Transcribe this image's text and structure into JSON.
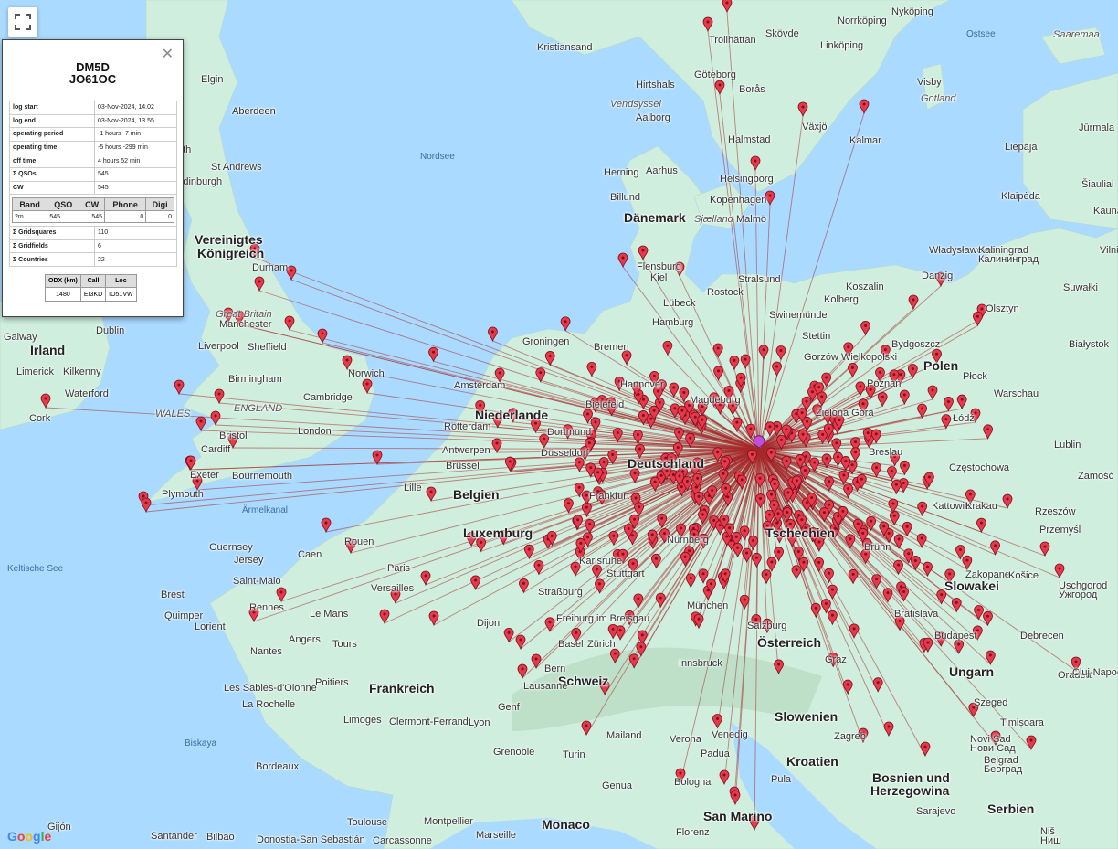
{
  "fullscreen_icon": "fullscreen-icon",
  "info": {
    "close_icon": "close-icon",
    "call": "DM5D",
    "locator": "JO61OC",
    "rows_top": [
      {
        "k": "log start",
        "v": "03-Nov-2024, 14.02"
      },
      {
        "k": "log end",
        "v": "03-Nov-2024, 13.55"
      },
      {
        "k": "operating period",
        "v": "-1 hours -7 min"
      },
      {
        "k": "operating time",
        "v": "-5 hours -299 min"
      },
      {
        "k": "off time",
        "v": "4 hours 52 min"
      },
      {
        "k": "Σ QSOs",
        "v": "545"
      },
      {
        "k": "CW",
        "v": "545"
      }
    ],
    "band_headers": [
      "Band",
      "QSO",
      "CW",
      "Phone",
      "Digi"
    ],
    "band_rows": [
      [
        "2m",
        "545",
        "545",
        "0",
        "0"
      ]
    ],
    "rows_bottom": [
      {
        "k": "Σ Gridsquares",
        "v": "110"
      },
      {
        "k": "Σ Gridfields",
        "v": "6"
      },
      {
        "k": "Σ Countries",
        "v": "22"
      }
    ],
    "odx_headers": [
      "ODX (km)",
      "Call",
      "Loc"
    ],
    "odx_row": [
      "1480",
      "EI3KD",
      "IO51VW"
    ]
  },
  "map": {
    "colors": {
      "sea": "#aadaff",
      "land": "#cfeedd",
      "line": "#a52a2a",
      "marker": "#e8394a",
      "home": "#c64bd8"
    },
    "home_marker_icon": "home-marker-icon",
    "station_marker_icon": "map-pin-icon",
    "labels": [
      {
        "t": "Vereinigtes",
        "c": "country"
      },
      {
        "t": "Königreich",
        "c": "country"
      },
      {
        "t": "Irland",
        "c": "country"
      },
      {
        "t": "Dänemark",
        "c": "country"
      },
      {
        "t": "Niederlande",
        "c": "country"
      },
      {
        "t": "Belgien",
        "c": "country"
      },
      {
        "t": "Luxemburg",
        "c": "country"
      },
      {
        "t": "Deutschland",
        "c": "country"
      },
      {
        "t": "Polen",
        "c": "country"
      },
      {
        "t": "Tschechien",
        "c": "country"
      },
      {
        "t": "Slowakei",
        "c": "country"
      },
      {
        "t": "Österreich",
        "c": "country"
      },
      {
        "t": "Ungarn",
        "c": "country"
      },
      {
        "t": "Schweiz",
        "c": "country"
      },
      {
        "t": "Frankreich",
        "c": "country"
      },
      {
        "t": "Slowenien",
        "c": "country"
      },
      {
        "t": "Kroatien",
        "c": "country"
      },
      {
        "t": "Bosnien und",
        "c": "country"
      },
      {
        "t": "Herzegowina",
        "c": "country"
      },
      {
        "t": "Serbien",
        "c": "country"
      },
      {
        "t": "Monaco",
        "c": "country"
      },
      {
        "t": "San Marino",
        "c": "country"
      },
      {
        "t": "Nordsee",
        "c": "sea"
      },
      {
        "t": "Ostsee",
        "c": "sea"
      },
      {
        "t": "Keltische See",
        "c": "sea"
      },
      {
        "t": "Ärmelkanal",
        "c": "sea"
      },
      {
        "t": "Biskaya",
        "c": "sea"
      },
      {
        "t": "Saaremaa",
        "c": "region"
      },
      {
        "t": "Gotland",
        "c": "region"
      },
      {
        "t": "Vendsyssel",
        "c": "region"
      },
      {
        "t": "Sjælland",
        "c": "region"
      },
      {
        "t": "Great Britain",
        "c": "region"
      },
      {
        "t": "ENGLAND",
        "c": "region"
      },
      {
        "t": "WALES",
        "c": "region"
      },
      {
        "t": "Guernsey",
        "c": "city"
      },
      {
        "t": "Jersey",
        "c": "city"
      },
      {
        "t": "Elgin",
        "c": "city"
      },
      {
        "t": "Aberdeen",
        "c": "city"
      },
      {
        "t": "Perth",
        "c": "city"
      },
      {
        "t": "St Andrews",
        "c": "city"
      },
      {
        "t": "Edinburgh",
        "c": "city"
      },
      {
        "t": "Durham",
        "c": "city"
      },
      {
        "t": "Dublin",
        "c": "city"
      },
      {
        "t": "Galway",
        "c": "city"
      },
      {
        "t": "Limerick",
        "c": "city"
      },
      {
        "t": "Kilkenny",
        "c": "city"
      },
      {
        "t": "Waterford",
        "c": "city"
      },
      {
        "t": "Cork",
        "c": "city"
      },
      {
        "t": "Liverpool",
        "c": "city"
      },
      {
        "t": "Manchester",
        "c": "city"
      },
      {
        "t": "Sheffield",
        "c": "city"
      },
      {
        "t": "Birmingham",
        "c": "city"
      },
      {
        "t": "Cambridge",
        "c": "city"
      },
      {
        "t": "Norwich",
        "c": "city"
      },
      {
        "t": "London",
        "c": "city"
      },
      {
        "t": "Bristol",
        "c": "city"
      },
      {
        "t": "Cardiff",
        "c": "city"
      },
      {
        "t": "Exeter",
        "c": "city"
      },
      {
        "t": "Plymouth",
        "c": "city"
      },
      {
        "t": "Bournemouth",
        "c": "city"
      },
      {
        "t": "Kristiansand",
        "c": "city"
      },
      {
        "t": "Trollhättan",
        "c": "city"
      },
      {
        "t": "Göteborg",
        "c": "city"
      },
      {
        "t": "Borås",
        "c": "city"
      },
      {
        "t": "Skövde",
        "c": "city"
      },
      {
        "t": "Linköping",
        "c": "city"
      },
      {
        "t": "Norrköping",
        "c": "city"
      },
      {
        "t": "Nyköping",
        "c": "city"
      },
      {
        "t": "Visby",
        "c": "city"
      },
      {
        "t": "Växjö",
        "c": "city"
      },
      {
        "t": "Kalmar",
        "c": "city"
      },
      {
        "t": "Halmstad",
        "c": "city"
      },
      {
        "t": "Helsingborg",
        "c": "city"
      },
      {
        "t": "Kopenhagen",
        "c": "city"
      },
      {
        "t": "Malmö",
        "c": "city"
      },
      {
        "t": "Hirtshals",
        "c": "city"
      },
      {
        "t": "Aalborg",
        "c": "city"
      },
      {
        "t": "Aarhus",
        "c": "city"
      },
      {
        "t": "Herning",
        "c": "city"
      },
      {
        "t": "Billund",
        "c": "city"
      },
      {
        "t": "Flensburg",
        "c": "city"
      },
      {
        "t": "Kiel",
        "c": "city"
      },
      {
        "t": "Lübeck",
        "c": "city"
      },
      {
        "t": "Stralsund",
        "c": "city"
      },
      {
        "t": "Rostock",
        "c": "city"
      },
      {
        "t": "Swinemünde",
        "c": "city"
      },
      {
        "t": "Hamburg",
        "c": "city"
      },
      {
        "t": "Bremen",
        "c": "city"
      },
      {
        "t": "Groningen",
        "c": "city"
      },
      {
        "t": "Amsterdam",
        "c": "city"
      },
      {
        "t": "Rotterdam",
        "c": "city"
      },
      {
        "t": "Antwerpen",
        "c": "city"
      },
      {
        "t": "Brüssel",
        "c": "city"
      },
      {
        "t": "Lille",
        "c": "city"
      },
      {
        "t": "Hannover",
        "c": "city"
      },
      {
        "t": "Bielefeld",
        "c": "city"
      },
      {
        "t": "Magdeburg",
        "c": "city"
      },
      {
        "t": "Dortmund",
        "c": "city"
      },
      {
        "t": "Düsseldorf",
        "c": "city"
      },
      {
        "t": "Frankfurt",
        "c": "city"
      },
      {
        "t": "Nürnberg",
        "c": "city"
      },
      {
        "t": "Stuttgart",
        "c": "city"
      },
      {
        "t": "Karlsruhe",
        "c": "city"
      },
      {
        "t": "Straßburg",
        "c": "city"
      },
      {
        "t": "Freiburg im Breisgau",
        "c": "city"
      },
      {
        "t": "München",
        "c": "city"
      },
      {
        "t": "Salzburg",
        "c": "city"
      },
      {
        "t": "Innsbruck",
        "c": "city"
      },
      {
        "t": "Basel",
        "c": "city"
      },
      {
        "t": "Zürich",
        "c": "city"
      },
      {
        "t": "Bern",
        "c": "city"
      },
      {
        "t": "Lausanne",
        "c": "city"
      },
      {
        "t": "Genf",
        "c": "city"
      },
      {
        "t": "Stettin",
        "c": "city"
      },
      {
        "t": "Gorzów Wielkopolski",
        "c": "city"
      },
      {
        "t": "Zielona Góra",
        "c": "city"
      },
      {
        "t": "Poznań",
        "c": "city"
      },
      {
        "t": "Bydgoszcz",
        "c": "city"
      },
      {
        "t": "Danzig",
        "c": "city"
      },
      {
        "t": "Kolberg",
        "c": "city"
      },
      {
        "t": "Koszalin",
        "c": "city"
      },
      {
        "t": "Władysławowo",
        "c": "city"
      },
      {
        "t": "Olsztyn",
        "c": "city"
      },
      {
        "t": "Białystok",
        "c": "city"
      },
      {
        "t": "Płock",
        "c": "city"
      },
      {
        "t": "Warschau",
        "c": "city"
      },
      {
        "t": "Łódź",
        "c": "city"
      },
      {
        "t": "Lublin",
        "c": "city"
      },
      {
        "t": "Breslau",
        "c": "city"
      },
      {
        "t": "Częstochowa",
        "c": "city"
      },
      {
        "t": "Kattowitz",
        "c": "city"
      },
      {
        "t": "Krakau",
        "c": "city"
      },
      {
        "t": "Zamość",
        "c": "city"
      },
      {
        "t": "Rzeszów",
        "c": "city"
      },
      {
        "t": "Przemyśl",
        "c": "city"
      },
      {
        "t": "Zakopane",
        "c": "city"
      },
      {
        "t": "Košice",
        "c": "city"
      },
      {
        "t": "Uschgorod",
        "c": "city"
      },
      {
        "t": "Brünn",
        "c": "city"
      },
      {
        "t": "Bratislava",
        "c": "city"
      },
      {
        "t": "Graz",
        "c": "city"
      },
      {
        "t": "Budapest",
        "c": "city"
      },
      {
        "t": "Debrecen",
        "c": "city"
      },
      {
        "t": "Oradea",
        "c": "city"
      },
      {
        "t": "Cluj-Napoca",
        "c": "city"
      },
      {
        "t": "Szeged",
        "c": "city"
      },
      {
        "t": "Timișoara",
        "c": "city"
      },
      {
        "t": "Novi Sad",
        "c": "city"
      },
      {
        "t": "Belgrad",
        "c": "city"
      },
      {
        "t": "Zagreb",
        "c": "city"
      },
      {
        "t": "Sarajevo",
        "c": "city"
      },
      {
        "t": "Pula",
        "c": "city"
      },
      {
        "t": "Venedig",
        "c": "city"
      },
      {
        "t": "Padua",
        "c": "city"
      },
      {
        "t": "Verona",
        "c": "city"
      },
      {
        "t": "Mailand",
        "c": "city"
      },
      {
        "t": "Turin",
        "c": "city"
      },
      {
        "t": "Genua",
        "c": "city"
      },
      {
        "t": "Bologna",
        "c": "city"
      },
      {
        "t": "Florenz",
        "c": "city"
      },
      {
        "t": "Grenoble",
        "c": "city"
      },
      {
        "t": "Lyon",
        "c": "city"
      },
      {
        "t": "Dijon",
        "c": "city"
      },
      {
        "t": "Paris",
        "c": "city"
      },
      {
        "t": "Versailles",
        "c": "city"
      },
      {
        "t": "Rouen",
        "c": "city"
      },
      {
        "t": "Caen",
        "c": "city"
      },
      {
        "t": "Rennes",
        "c": "city"
      },
      {
        "t": "Brest",
        "c": "city"
      },
      {
        "t": "Quimper",
        "c": "city"
      },
      {
        "t": "Lorient",
        "c": "city"
      },
      {
        "t": "Saint-Malo",
        "c": "city"
      },
      {
        "t": "Le Mans",
        "c": "city"
      },
      {
        "t": "Tours",
        "c": "city"
      },
      {
        "t": "Nantes",
        "c": "city"
      },
      {
        "t": "Angers",
        "c": "city"
      },
      {
        "t": "Poitiers",
        "c": "city"
      },
      {
        "t": "Les Sables-d'Olonne",
        "c": "city"
      },
      {
        "t": "La Rochelle",
        "c": "city"
      },
      {
        "t": "Limoges",
        "c": "city"
      },
      {
        "t": "Clermont-Ferrand",
        "c": "city"
      },
      {
        "t": "Bordeaux",
        "c": "city"
      },
      {
        "t": "Toulouse",
        "c": "city"
      },
      {
        "t": "Montpellier",
        "c": "city"
      },
      {
        "t": "Marseille",
        "c": "city"
      },
      {
        "t": "Carcassonne",
        "c": "city"
      },
      {
        "t": "Donostia-San Sebastián",
        "c": "city"
      },
      {
        "t": "Bilbao",
        "c": "city"
      },
      {
        "t": "Santander",
        "c": "city"
      },
      {
        "t": "Gijón",
        "c": "city"
      },
      {
        "t": "Klaipėda",
        "c": "city"
      },
      {
        "t": "Šiauliai",
        "c": "city"
      },
      {
        "t": "Jūrmala",
        "c": "city"
      },
      {
        "t": "Liepāja",
        "c": "city"
      },
      {
        "t": "Kaliningrad",
        "c": "city"
      },
      {
        "t": "Калининград",
        "c": "city"
      },
      {
        "t": "Suwałki",
        "c": "city"
      },
      {
        "t": "Kaunas",
        "c": "city"
      },
      {
        "t": "Ужгород",
        "c": "city"
      },
      {
        "t": "Ниш",
        "c": "city"
      },
      {
        "t": "Нови Сад",
        "c": "city"
      },
      {
        "t": "Београд",
        "c": "city"
      },
      {
        "t": "Niš",
        "c": "city"
      },
      {
        "t": "Vilnius",
        "c": "city"
      }
    ]
  },
  "google_logo": "Google"
}
